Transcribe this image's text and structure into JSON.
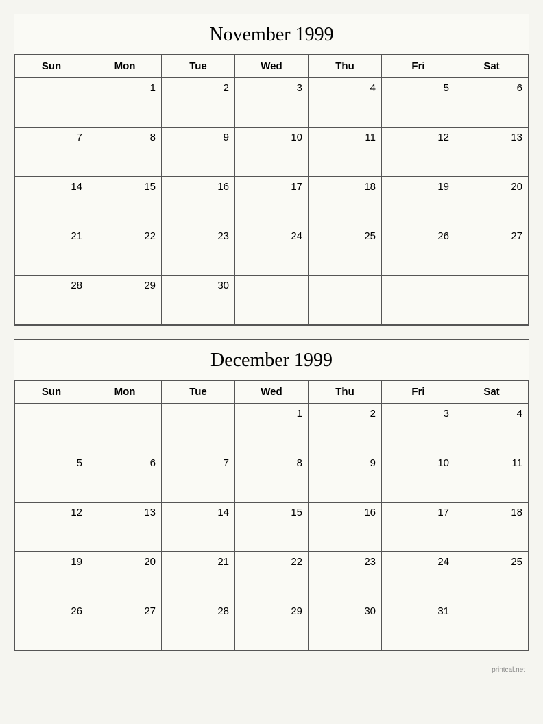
{
  "november": {
    "title": "November 1999",
    "headers": [
      "Sun",
      "Mon",
      "Tue",
      "Wed",
      "Thu",
      "Fri",
      "Sat"
    ],
    "weeks": [
      [
        null,
        1,
        2,
        3,
        4,
        5,
        6
      ],
      [
        7,
        8,
        9,
        10,
        11,
        12,
        13
      ],
      [
        14,
        15,
        16,
        17,
        18,
        19,
        20
      ],
      [
        21,
        22,
        23,
        24,
        25,
        26,
        27
      ],
      [
        28,
        29,
        30,
        null,
        null,
        null,
        null
      ]
    ]
  },
  "december": {
    "title": "December 1999",
    "headers": [
      "Sun",
      "Mon",
      "Tue",
      "Wed",
      "Thu",
      "Fri",
      "Sat"
    ],
    "weeks": [
      [
        null,
        null,
        null,
        1,
        2,
        3,
        4
      ],
      [
        5,
        6,
        7,
        8,
        9,
        10,
        11
      ],
      [
        12,
        13,
        14,
        15,
        16,
        17,
        18
      ],
      [
        19,
        20,
        21,
        22,
        23,
        24,
        25
      ],
      [
        26,
        27,
        28,
        29,
        30,
        31,
        null
      ]
    ]
  },
  "watermark": "printcal.net"
}
